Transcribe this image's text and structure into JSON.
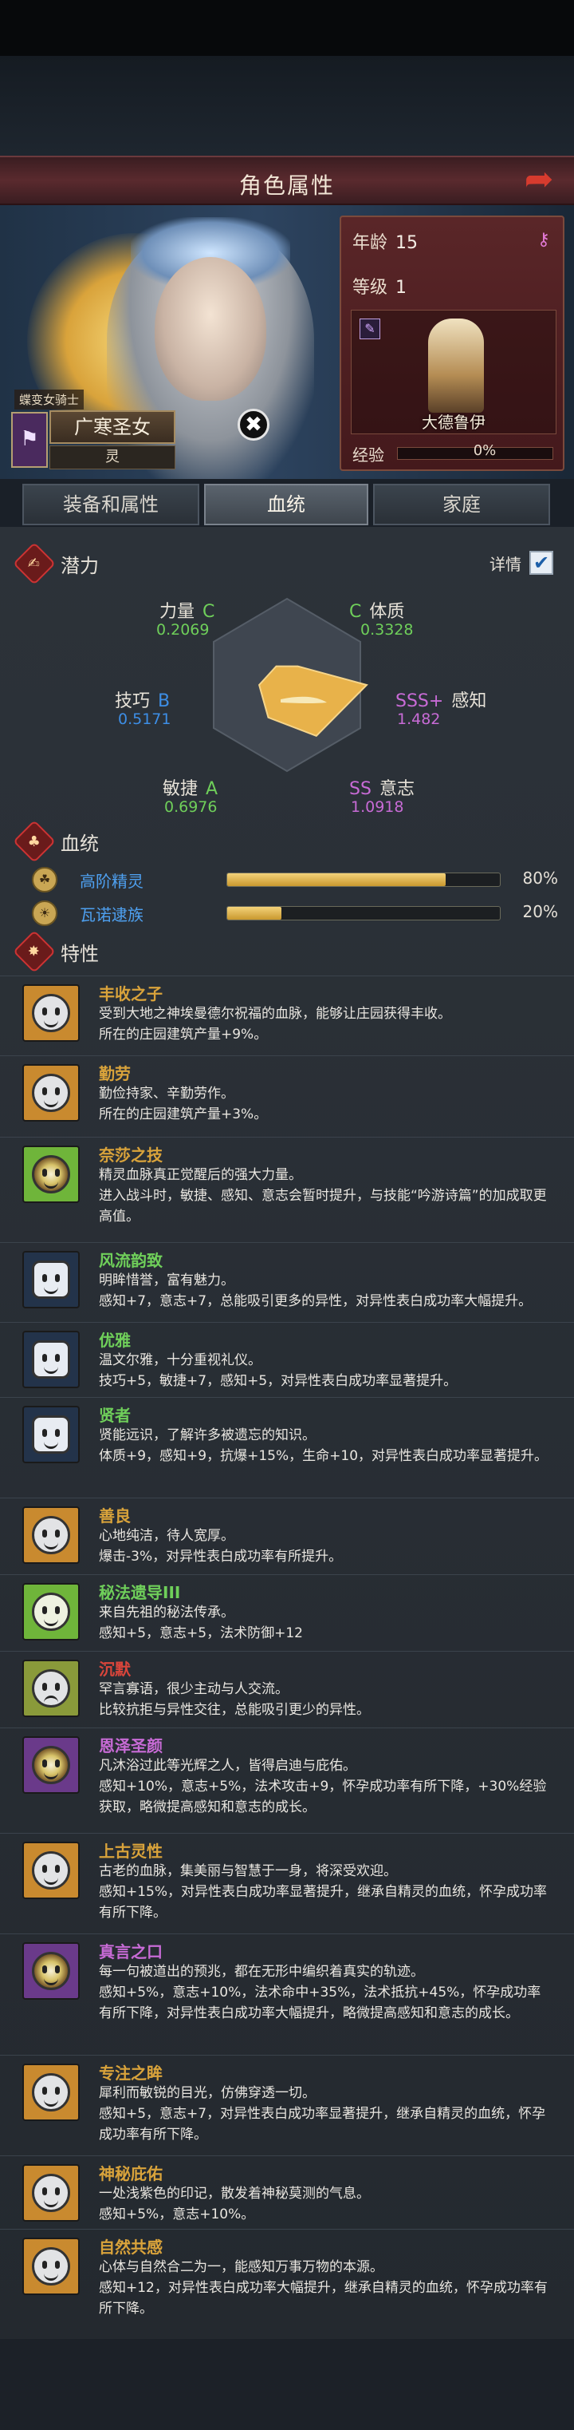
{
  "header": {
    "title": "角色属性",
    "back_icon": "back-arrow-icon"
  },
  "character": {
    "class_tag": "蝶变女骑士",
    "name": "广寒圣女",
    "spirit": "灵",
    "emblem_icon": "banner-icon"
  },
  "info": {
    "age_label": "年龄",
    "age": "15",
    "level_label": "等级",
    "level": "1",
    "role_name": "大德鲁伊",
    "exp_label": "经验",
    "exp_pct": "0%",
    "exp_value": 0
  },
  "tabs": [
    {
      "label": "装备和属性"
    },
    {
      "label": "血统"
    },
    {
      "label": "家庭"
    }
  ],
  "active_tab": 1,
  "potential": {
    "title": "潜力",
    "detail_label": "详情",
    "detail_checked": true,
    "stats": {
      "strength": {
        "name": "力量",
        "grade": "C",
        "value": "0.2069"
      },
      "constitution": {
        "name": "体质",
        "grade": "C",
        "value": "0.3328"
      },
      "skill": {
        "name": "技巧",
        "grade": "B",
        "value": "0.5171"
      },
      "perception": {
        "name": "感知",
        "grade": "SSS+",
        "value": "1.482"
      },
      "agility": {
        "name": "敏捷",
        "grade": "A",
        "value": "0.6976"
      },
      "will": {
        "name": "意志",
        "grade": "SS",
        "value": "1.0918"
      }
    },
    "radar_values": {
      "strength": 0.2069,
      "constitution": 0.3328,
      "perception": 1.482,
      "will": 1.0918,
      "agility": 0.6976,
      "skill": 0.5171
    },
    "colors": {
      "grade_C": "#6fcf5a",
      "grade_B": "#3d8ee6",
      "grade_A": "#6fcf5a",
      "grade_SS": "#c86bd6",
      "shape": "#e8b24a"
    }
  },
  "bloodline": {
    "title": "血统",
    "items": [
      {
        "name": "高阶精灵",
        "pct": "80%",
        "value": 80
      },
      {
        "name": "瓦诺逮族",
        "pct": "20%",
        "value": 20
      }
    ]
  },
  "traits": {
    "title": "特性",
    "items": [
      {
        "name": "丰收之子",
        "color": "#d9a33b",
        "icon": "smile-face-icon",
        "icon_bg": "#c98a2f",
        "desc": "受到大地之神埃曼德尔祝福的血脉，能够让庄园获得丰收。\n所在的庄园建筑产量+9%。"
      },
      {
        "name": "勤劳",
        "color": "#d9a33b",
        "icon": "smile-face-icon",
        "icon_bg": "#c98a2f",
        "desc": "勤俭持家、辛勤劳作。\n所在的庄园建筑产量+3%。"
      },
      {
        "name": "奈莎之技",
        "color": "#d9a33b",
        "icon": "spiral-eye-icon",
        "icon_bg": "#6fb53a",
        "desc": "精灵血脉真正觉醒后的强大力量。\n进入战斗时，敏捷、感知、意志会暂时提升，与技能“吟游诗篇”的加成取更高值。"
      },
      {
        "name": "风流韵致",
        "color": "#6fcf5a",
        "icon": "muscle-arm-icon",
        "icon_bg": "#23334a",
        "desc": "明眸惜誉，富有魅力。\n感知+7，意志+7，总能吸引更多的异性，对异性表白成功率大幅提升。"
      },
      {
        "name": "优雅",
        "color": "#6fcf5a",
        "icon": "muscle-arm-icon",
        "icon_bg": "#23334a",
        "desc": "温文尔雅，十分重视礼仪。\n技巧+5，敏捷+7，感知+5，对异性表白成功率显著提升。"
      },
      {
        "name": "贤者",
        "color": "#6fcf5a",
        "icon": "muscle-arm-icon",
        "icon_bg": "#23334a",
        "desc": "贤能远识，了解许多被遗忘的知识。\n体质+9，感知+9，抗爆+15%，生命+10，对异性表白成功率显著提升。"
      },
      {
        "name": "善良",
        "color": "#d9a33b",
        "icon": "smile-face-icon",
        "icon_bg": "#c98a2f",
        "desc": "心地纯洁，待人宽厚。\n爆击-3%，对异性表白成功率有所提升。"
      },
      {
        "name": "秘法遗导III",
        "color": "#6fcf5a",
        "icon": "leaf-hand-icon",
        "icon_bg": "#6fb53a",
        "desc": "来自先祖的秘法传承。\n感知+5，意志+5，法术防御+12"
      },
      {
        "name": "沉默",
        "color": "#d9453b",
        "icon": "sad-face-icon",
        "icon_bg": "#8a9a3a",
        "desc": "罕言寡语，很少主动与人交流。\n比较抗拒与异性交往，总能吸引更少的异性。"
      },
      {
        "name": "恩泽圣颜",
        "color": "#c86bd6",
        "icon": "spiral-eye-icon",
        "icon_bg": "#6a3a8a",
        "desc": "凡沐浴过此等光辉之人，皆得启迪与庇佑。\n感知+10%，意志+5%，法术攻击+9，怀孕成功率有所下降，+30%经验获取，略微提高感知和意志的成长。"
      },
      {
        "name": "上古灵性",
        "color": "#d9a33b",
        "icon": "smile-face-icon",
        "icon_bg": "#c98a2f",
        "desc": "古老的血脉，集美丽与智慧于一身，将深受欢迎。\n感知+15%，对异性表白成功率显著提升，继承自精灵的血统，怀孕成功率有所下降。"
      },
      {
        "name": "真言之口",
        "color": "#c86bd6",
        "icon": "spiral-eye-icon",
        "icon_bg": "#6a3a8a",
        "desc": "每一句被道出的预兆，都在无形中编织着真实的轨迹。\n感知+5%，意志+10%，法术命中+35%，法术抵抗+45%，怀孕成功率有所下降，对异性表白成功率大幅提升，略微提高感知和意志的成长。"
      },
      {
        "name": "专注之眸",
        "color": "#d9a33b",
        "icon": "smile-face-icon",
        "icon_bg": "#c98a2f",
        "desc": "犀利而敏锐的目光，仿佛穿透一切。\n感知+5，意志+7，对异性表白成功率显著提升，继承自精灵的血统，怀孕成功率有所下降。"
      },
      {
        "name": "神秘庇佑",
        "color": "#d9a33b",
        "icon": "smile-face-icon",
        "icon_bg": "#c98a2f",
        "desc": "一处浅紫色的印记，散发着神秘莫测的气息。\n感知+5%，意志+10%。"
      },
      {
        "name": "自然共感",
        "color": "#d9a33b",
        "icon": "smile-face-icon",
        "icon_bg": "#c98a2f",
        "desc": "心体与自然合二为一，能感知万事万物的本源。\n感知+12，对异性表白成功率大幅提升，继承自精灵的血统，怀孕成功率有所下降。"
      }
    ]
  }
}
